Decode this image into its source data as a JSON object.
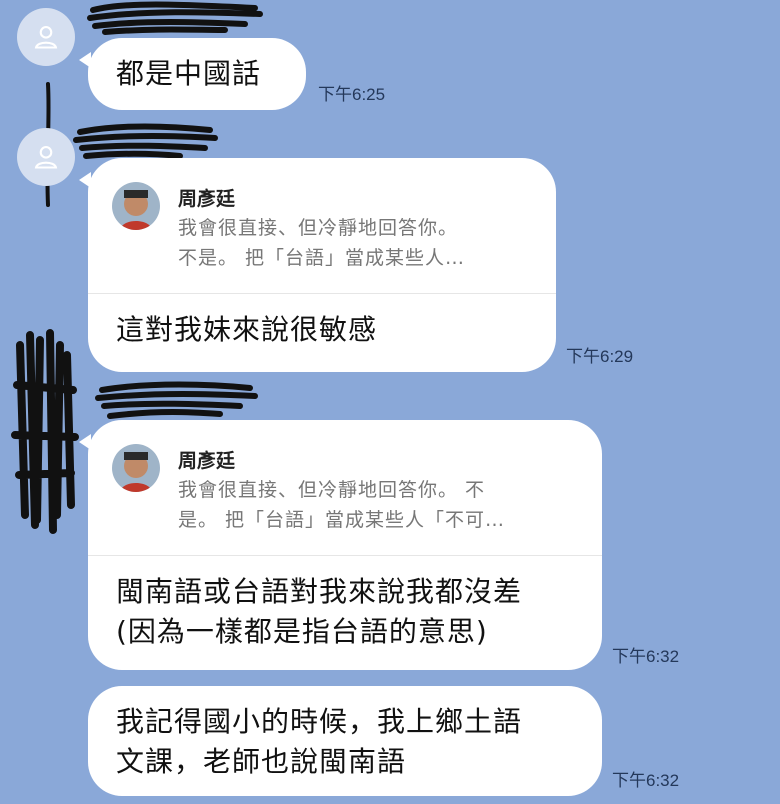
{
  "messages": [
    {
      "text": "都是中國話",
      "time": "下午6:25"
    },
    {
      "quote": {
        "author": "周彥廷",
        "line1": "我會很直接、但冷靜地回答你。",
        "line2": "不是。 把「台語」當成某些人…"
      },
      "text": "這對我妹來說很敏感",
      "time": "下午6:29"
    },
    {
      "quote": {
        "author": "周彥廷",
        "line1": "我會很直接、但冷靜地回答你。 不",
        "line2": "是。 把「台語」當成某些人「不可…"
      },
      "text_line1": "閩南語或台語對我來說我都沒差",
      "text_line2": "(因為一樣都是指台語的意思)",
      "time": "下午6:32"
    },
    {
      "text_line1": "我記得國小的時候，我上鄉土語",
      "text_line2": "文課，老師也說閩南語",
      "time": "下午6:32"
    }
  ],
  "icons": {
    "avatar": "default-user-icon"
  },
  "colors": {
    "background": "#8aa8d8",
    "bubble": "#ffffff",
    "avatar_bg": "#d5dff0",
    "time_text": "#24385a"
  }
}
